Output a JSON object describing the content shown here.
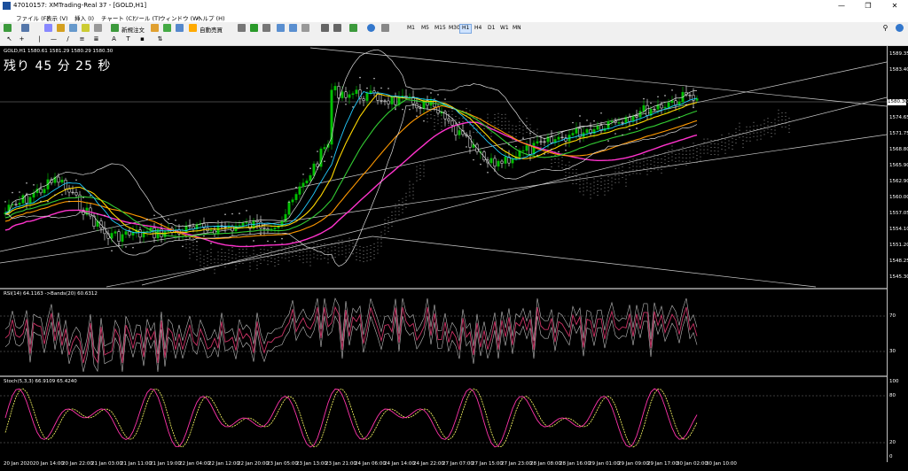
{
  "window": {
    "title": "47010157: XMTrading-Real 37 - [GOLD,H1]",
    "minimize": "—",
    "maximize": "❐",
    "close": "✕"
  },
  "menu": [
    "ファイル (F)",
    "表示 (V)",
    "挿入 (I)",
    "チャート (C)",
    "ツール (T)",
    "ウィンドウ (W)",
    "ヘルプ (H)"
  ],
  "toolbar": {
    "new_order": "新規注文",
    "auto_trade": "自動売買",
    "timeframes": [
      "M1",
      "M5",
      "M15",
      "M30",
      "H1",
      "H4",
      "D1",
      "W1",
      "MN"
    ],
    "active_timeframe": "H1"
  },
  "chart": {
    "symbol_label": "GOLD,H1 1580.61 1581.29 1580.29 1580.30",
    "countdown": "残り 45 分 25 秒",
    "current_price": "1580.30",
    "price_axis": [
      "1589.35",
      "1583.40",
      "1580.30",
      "1577.60",
      "1574.65",
      "1571.75",
      "1568.80",
      "1565.90",
      "1562.90",
      "1560.00",
      "1557.05",
      "1554.10",
      "1551.20",
      "1548.25",
      "1545.30"
    ],
    "rsi_label": "RSI(14) 64.1163  ->Bands(20) 60.6312",
    "rsi_axis": [
      "70",
      "30"
    ],
    "stoch_label": "Stoch(5,3,3) 66.9109 65.4240",
    "stoch_axis": [
      "100",
      "80",
      "20",
      "0"
    ],
    "time_axis": [
      "20 Jan 2020",
      "20 Jan 14:00",
      "20 Jan 22:00",
      "21 Jan 03:00",
      "21 Jan 11:00",
      "21 Jan 19:00",
      "22 Jan 04:00",
      "22 Jan 12:00",
      "22 Jan 20:00",
      "23 Jan 05:00",
      "23 Jan 13:00",
      "23 Jan 21:00",
      "24 Jan 06:00",
      "24 Jan 14:00",
      "24 Jan 22:00",
      "27 Jan 07:00",
      "27 Jan 15:00",
      "27 Jan 23:00",
      "28 Jan 08:00",
      "28 Jan 16:00",
      "29 Jan 01:00",
      "29 Jan 09:00",
      "29 Jan 17:00",
      "30 Jan 02:00",
      "30 Jan 10:00"
    ],
    "colors": {
      "background": "#000000",
      "bull_candle": "#00c000",
      "bear_candle": "#ffffff",
      "ma_yellow": "#ffd700",
      "ma_orange": "#ff9900",
      "ma_green": "#33cc33",
      "ma_magenta": "#ff33cc",
      "tenkan_cyan": "#22ccff",
      "kijun_red": "#cc0000",
      "rsi_line": "#cc3366",
      "stoch_main": "#ff33aa",
      "stoch_signal": "#ffff66"
    }
  }
}
